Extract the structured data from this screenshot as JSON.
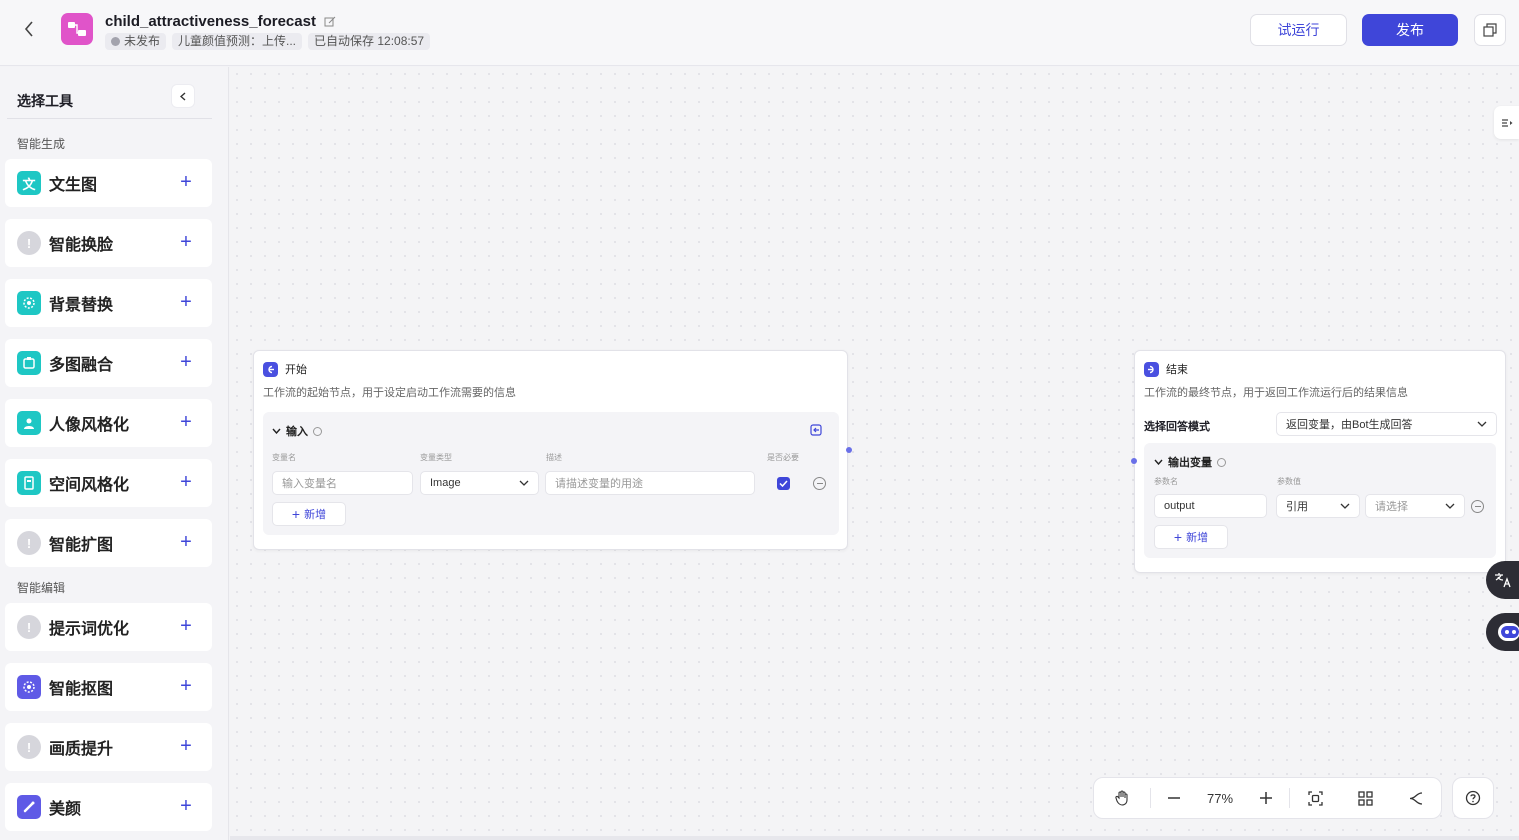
{
  "header": {
    "title": "child_attractiveness_forecast",
    "status": "未发布",
    "description": "儿童颜值预测：上传...",
    "autosave": "已自动保存 12:08:57",
    "trial_run_label": "试运行",
    "publish_label": "发布"
  },
  "sidebar": {
    "title": "选择工具",
    "groups": [
      {
        "label": "智能生成",
        "items": [
          {
            "label": "文生图",
            "icon": "text-to-image-icon",
            "color": "#1ec7c4"
          },
          {
            "label": "智能换脸",
            "icon": "warning-icon",
            "color": "#d6d6dc"
          },
          {
            "label": "背景替换",
            "icon": "background-replace-icon",
            "color": "#1ec7c4"
          },
          {
            "label": "多图融合",
            "icon": "multi-image-icon",
            "color": "#1ec7c4"
          },
          {
            "label": "人像风格化",
            "icon": "portrait-icon",
            "color": "#1ec7c4"
          },
          {
            "label": "空间风格化",
            "icon": "space-icon",
            "color": "#1ec7c4"
          },
          {
            "label": "智能扩图",
            "icon": "warning-icon",
            "color": "#d6d6dc"
          }
        ]
      },
      {
        "label": "智能编辑",
        "items": [
          {
            "label": "提示词优化",
            "icon": "warning-icon",
            "color": "#d6d6dc"
          },
          {
            "label": "智能抠图",
            "icon": "cutout-icon",
            "color": "#5f5ae6"
          },
          {
            "label": "画质提升",
            "icon": "warning-icon",
            "color": "#d6d6dc"
          },
          {
            "label": "美颜",
            "icon": "beauty-icon",
            "color": "#5f5ae6"
          }
        ]
      }
    ]
  },
  "start_node": {
    "title": "开始",
    "description": "工作流的起始节点，用于设定启动工作流需要的信息",
    "input_label": "输入",
    "col_name": "变量名",
    "col_type": "变量类型",
    "col_desc": "描述",
    "col_required": "是否必要",
    "name_placeholder": "输入变量名",
    "type_value": "Image",
    "desc_placeholder": "请描述变量的用途",
    "add_label": "新增"
  },
  "end_node": {
    "title": "结束",
    "description": "工作流的最终节点，用于返回工作流运行后的结果信息",
    "mode_label": "选择回答模式",
    "mode_value": "返回变量，由Bot生成回答",
    "output_label": "输出变量",
    "col_param": "参数名",
    "col_value": "参数值",
    "param_name": "output",
    "ref_value": "引用",
    "select_placeholder": "请选择",
    "add_label": "新增"
  },
  "toolbar": {
    "zoom": "77%"
  }
}
